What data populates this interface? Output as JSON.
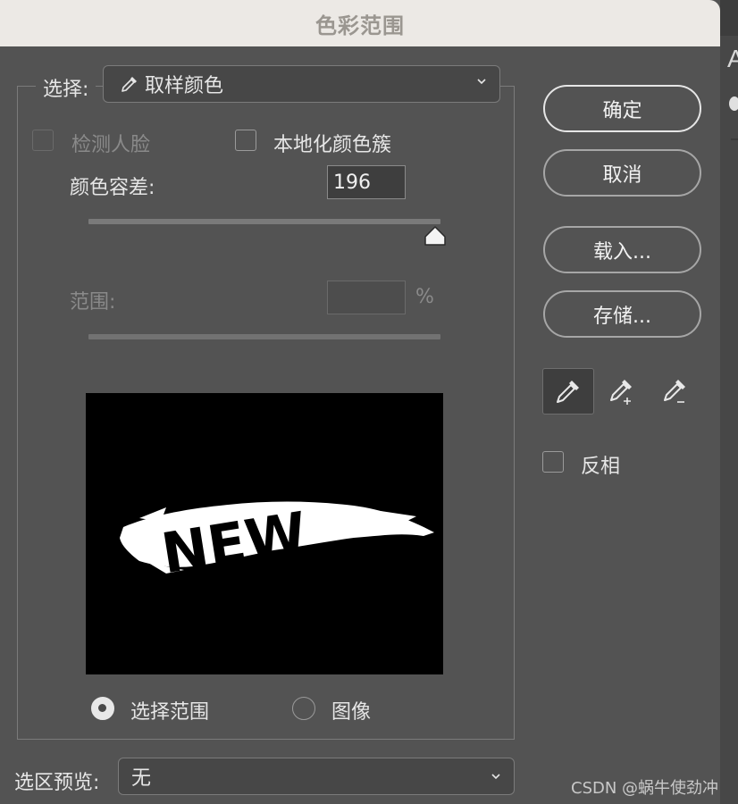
{
  "window": {
    "title": "色彩范围"
  },
  "side_strip": {
    "letter": "A"
  },
  "select_group": {
    "label": "选择:",
    "value": "取样颜色"
  },
  "options": {
    "detect_faces": {
      "label": "检测人脸",
      "checked": false,
      "enabled": false
    },
    "localized_clusters": {
      "label": "本地化颜色簇",
      "checked": false,
      "enabled": true
    }
  },
  "fuzziness": {
    "label": "颜色容差:",
    "value": "196",
    "max": 200
  },
  "range": {
    "label": "范围:",
    "value": "",
    "unit": "%",
    "enabled": false
  },
  "preview": {
    "text": "NEW"
  },
  "view_mode": {
    "selection": {
      "label": "选择范围",
      "selected": true
    },
    "image": {
      "label": "图像",
      "selected": false
    }
  },
  "selection_preview": {
    "label": "选区预览:",
    "value": "无"
  },
  "buttons": {
    "ok": "确定",
    "cancel": "取消",
    "load": "载入...",
    "save": "存储..."
  },
  "tools": [
    "eyedropper-icon",
    "eyedropper-plus-icon",
    "eyedropper-minus-icon"
  ],
  "invert": {
    "label": "反相",
    "checked": false
  },
  "watermark": "CSDN @蜗牛使劲冲"
}
